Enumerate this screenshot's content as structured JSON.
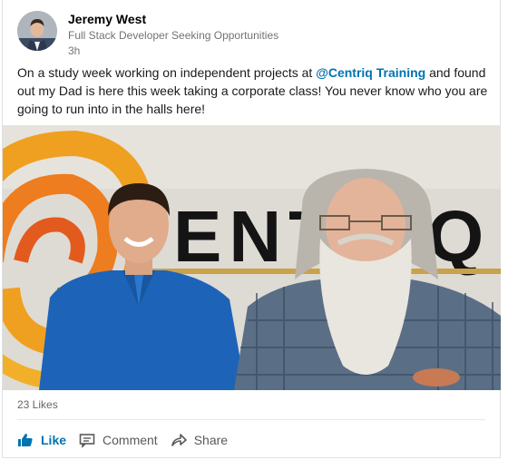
{
  "author": {
    "name": "Jeremy West",
    "headline": "Full Stack Developer Seeking Opportunities",
    "time": "3h"
  },
  "post": {
    "text_before": "On a study week working on independent projects at ",
    "mention": "@Centriq Training",
    "text_after": " and found out my Dad is here this week taking a corporate class! You never know who you are going to run into in the halls here!"
  },
  "photo": {
    "wall_sign_text": "ENTRIQ"
  },
  "social": {
    "likes": "23 Likes"
  },
  "actions": {
    "like": "Like",
    "comment": "Comment",
    "share": "Share"
  },
  "icons": {
    "like": "thumbs-up-icon",
    "comment": "comment-icon",
    "share": "share-arrow-icon"
  },
  "colors": {
    "accent": "#0073b1",
    "muted": "#737373"
  }
}
